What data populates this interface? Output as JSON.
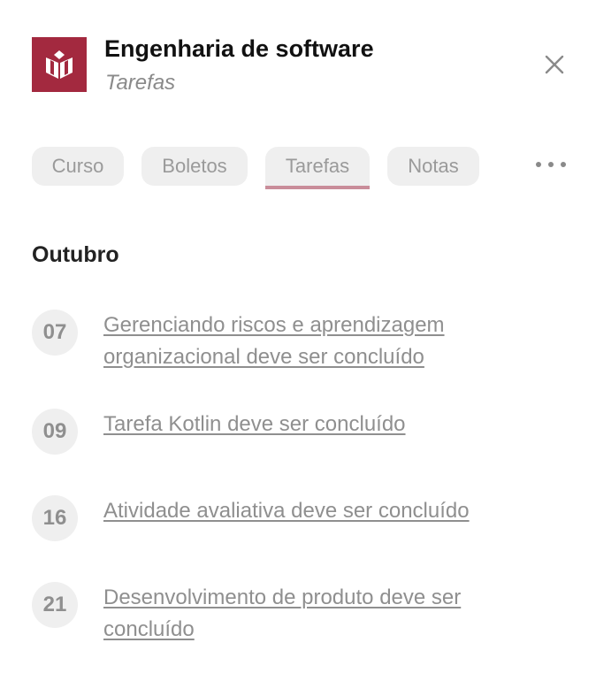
{
  "header": {
    "title": "Engenharia de software",
    "subtitle": "Tarefas",
    "logo_icon": "book-shield-icon",
    "close_icon": "close-icon"
  },
  "tabs": [
    {
      "label": "Curso"
    },
    {
      "label": "Boletos"
    },
    {
      "label": "Tarefas",
      "active": true
    },
    {
      "label": "Notas"
    }
  ],
  "more_icon": "more-horizontal-icon",
  "section": {
    "title": "Outubro",
    "tasks": [
      {
        "day": "07",
        "text": "Gerenciando riscos e aprendizagem organizacional deve ser concluído"
      },
      {
        "day": "09",
        "text": "Tarefa Kotlin deve ser concluído"
      },
      {
        "day": "16",
        "text": "Atividade avaliativa deve ser concluído"
      },
      {
        "day": "21",
        "text": "Desenvolvimento de produto deve ser concluído"
      }
    ]
  },
  "colors": {
    "brand": "#a3293f",
    "active_underline": "#c98d9a",
    "muted_text": "#8f8f8f",
    "chip_bg": "#efefef"
  }
}
